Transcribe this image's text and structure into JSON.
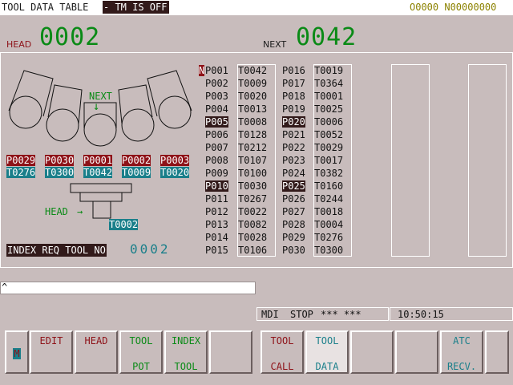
{
  "header": {
    "title": "TOOL DATA TABLE",
    "tm_status": "- TM IS OFF",
    "program_numbers": "O0000 N00000000"
  },
  "head": {
    "label": "HEAD",
    "value": "0002"
  },
  "next": {
    "label": "NEXT",
    "value": "0042"
  },
  "diagram": {
    "next_label": "NEXT",
    "next_arrow": "↓",
    "pots": [
      "P0029",
      "P0030",
      "P0001",
      "P0002",
      "P0003"
    ],
    "tools": [
      "T0276",
      "T0300",
      "T0042",
      "T0009",
      "T0020"
    ],
    "head_label": "HEAD",
    "head_arrow": "→",
    "head_tool": "T0002"
  },
  "index_req": {
    "label": "INDEX REQ TOOL NO",
    "value": "0002"
  },
  "table": {
    "cursor_char": "N",
    "col1_pots": [
      "P001",
      "P002",
      "P003",
      "P004",
      "P005",
      "P006",
      "P007",
      "P008",
      "P009",
      "P010",
      "P011",
      "P012",
      "P013",
      "P014",
      "P015"
    ],
    "col1_tools": [
      "T0042",
      "T0009",
      "T0020",
      "T0013",
      "T0008",
      "T0128",
      "T0212",
      "T0107",
      "T0100",
      "T0030",
      "T0267",
      "T0022",
      "T0082",
      "T0028",
      "T0106"
    ],
    "col2_pots": [
      "P016",
      "P017",
      "P018",
      "P019",
      "P020",
      "P021",
      "P022",
      "P023",
      "P024",
      "P025",
      "P026",
      "P027",
      "P028",
      "P029",
      "P030"
    ],
    "col2_tools": [
      "T0019",
      "T0364",
      "T0001",
      "T0025",
      "T0006",
      "T0052",
      "T0029",
      "T0017",
      "T0382",
      "T0160",
      "T0244",
      "T0018",
      "T0004",
      "T0276",
      "T0300"
    ],
    "highlighted_pots": [
      "P005",
      "P010",
      "P020",
      "P025"
    ]
  },
  "input_line": {
    "prompt": "^",
    "value": ""
  },
  "status": {
    "mode": "MDI",
    "state": "STOP",
    "flags": "*** ***",
    "time": "10:50:15"
  },
  "softkeys": [
    {
      "line1": "M",
      "line2": ""
    },
    {
      "line1": "EDIT",
      "line2": ""
    },
    {
      "line1": "HEAD",
      "line2": ""
    },
    {
      "line1": "TOOL",
      "line2": "POT"
    },
    {
      "line1": "INDEX",
      "line2": "TOOL"
    },
    {
      "line1": "",
      "line2": ""
    },
    {
      "line1": "TOOL",
      "line2": "CALL"
    },
    {
      "line1": "TOOL",
      "line2": "DATA"
    },
    {
      "line1": "",
      "line2": ""
    },
    {
      "line1": "",
      "line2": ""
    },
    {
      "line1": "ATC",
      "line2": "RECV."
    },
    {
      "line1": "",
      "line2": ""
    }
  ],
  "colors": {
    "background": "#c8bcbc",
    "dark_label": "#321a1a",
    "pot_red": "#8e1218",
    "tool_teal": "#1a7f8a",
    "big_number_green": "#0a8a16"
  }
}
